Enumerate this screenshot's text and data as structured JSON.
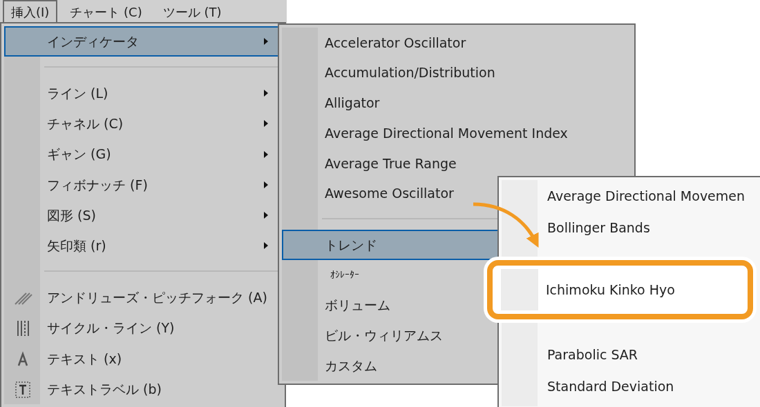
{
  "menubar": [
    {
      "label": "挿入(I)",
      "selected": true
    },
    {
      "label": "チャート (C)",
      "selected": false
    },
    {
      "label": "ツール (T)",
      "selected": false
    }
  ],
  "insert_menu": [
    {
      "kind": "item",
      "label": "インディケータ",
      "selected": true,
      "submenu": true
    },
    {
      "kind": "separator"
    },
    {
      "kind": "item",
      "label": "ライン (L)",
      "selected": false,
      "submenu": true
    },
    {
      "kind": "item",
      "label": "チャネル (C)",
      "selected": false,
      "submenu": true
    },
    {
      "kind": "item",
      "label": "ギャン (G)",
      "selected": false,
      "submenu": true
    },
    {
      "kind": "item",
      "label": "フィボナッチ (F)",
      "selected": false,
      "submenu": true
    },
    {
      "kind": "item",
      "label": "図形 (S)",
      "selected": false,
      "submenu": true
    },
    {
      "kind": "item",
      "label": "矢印類 (r)",
      "selected": false,
      "submenu": true
    },
    {
      "kind": "separator"
    },
    {
      "kind": "item",
      "label": "アンドリューズ・ピッチフォーク (A)",
      "selected": false,
      "submenu": false,
      "icon": true
    },
    {
      "kind": "item",
      "label": "サイクル・ライン (Y)",
      "selected": false,
      "submenu": false,
      "icon": true
    },
    {
      "kind": "item",
      "label": "テキスト (x)",
      "selected": false,
      "submenu": false,
      "icon": true
    },
    {
      "kind": "item",
      "label": "テキストラベル (b)",
      "selected": false,
      "submenu": false,
      "icon": true
    }
  ],
  "indicator_menu": [
    {
      "kind": "item",
      "label": "Accelerator Oscillator",
      "selected": false
    },
    {
      "kind": "item",
      "label": "Accumulation/Distribution",
      "selected": false
    },
    {
      "kind": "item",
      "label": "Alligator",
      "selected": false
    },
    {
      "kind": "item",
      "label": "Average Directional Movement Index",
      "selected": false
    },
    {
      "kind": "item",
      "label": "Average True Range",
      "selected": false
    },
    {
      "kind": "item",
      "label": "Awesome Oscillator",
      "selected": false
    },
    {
      "kind": "separator"
    },
    {
      "kind": "item",
      "label": "トレンド",
      "selected": true
    },
    {
      "kind": "small",
      "label": "ｵｼﾚｰﾀｰ",
      "selected": false
    },
    {
      "kind": "item",
      "label": "ボリューム",
      "selected": false
    },
    {
      "kind": "item",
      "label": "ビル・ウィリアムス",
      "selected": false
    },
    {
      "kind": "item",
      "label": "カスタム",
      "selected": false
    }
  ],
  "trend_menu": [
    {
      "kind": "item",
      "label": "Average Directional Movemen"
    },
    {
      "kind": "item",
      "label": "Bollinger Bands"
    },
    {
      "kind": "covered"
    },
    {
      "kind": "highlighted",
      "label": "Ichimoku Kinko Hyo"
    },
    {
      "kind": "covered"
    },
    {
      "kind": "item",
      "label": "Parabolic SAR"
    },
    {
      "kind": "item",
      "label": "Standard Deviation"
    }
  ]
}
